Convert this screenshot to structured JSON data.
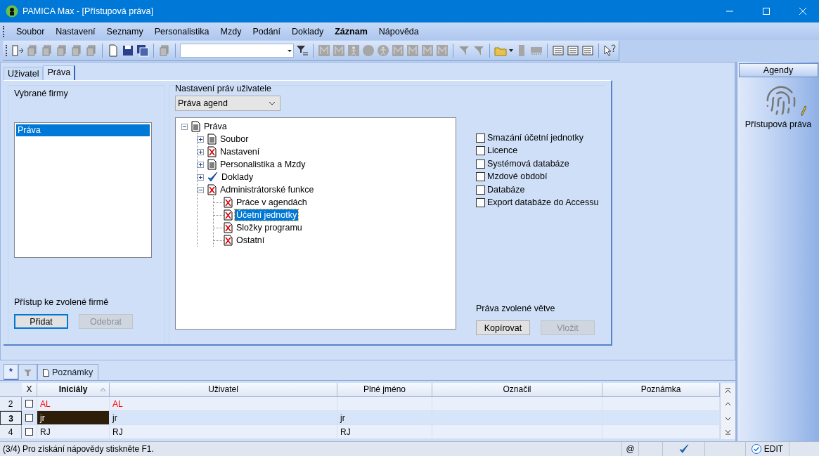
{
  "window": {
    "title": "PAMICA Max - [Přístupová práva]"
  },
  "menu": [
    {
      "label": "Soubor",
      "bold": false
    },
    {
      "label": "Nastavení",
      "bold": false
    },
    {
      "label": "Seznamy",
      "bold": false
    },
    {
      "label": "Personalistika",
      "bold": false
    },
    {
      "label": "Mzdy",
      "bold": false
    },
    {
      "label": "Podání",
      "bold": false
    },
    {
      "label": "Doklady",
      "bold": false
    },
    {
      "label": "Záznam",
      "bold": true
    },
    {
      "label": "Nápověda",
      "bold": false
    }
  ],
  "tabs": [
    {
      "label": "Uživatel",
      "selected": false
    },
    {
      "label": "Práva",
      "selected": true
    }
  ],
  "companies": {
    "title": "Vybrané firmy",
    "items": [
      {
        "label": "Práva",
        "selected": true
      }
    ],
    "access_label": "Přístup ke zvolené firmě",
    "buttons": [
      {
        "label": "Přidat",
        "disabled": false
      },
      {
        "label": "Odebrat",
        "disabled": true
      }
    ]
  },
  "rights": {
    "title": "Nastavení práv uživatele",
    "select": {
      "value": "Práva agend"
    },
    "tree": [
      {
        "label": "Práva",
        "kind": "doc",
        "expanded": true,
        "selected": false,
        "children": [
          {
            "label": "Soubor",
            "kind": "doc",
            "expanded": false,
            "selected": false
          },
          {
            "label": "Nastavení",
            "kind": "denied",
            "expanded": false,
            "selected": false
          },
          {
            "label": "Personalistika a Mzdy",
            "kind": "doc",
            "expanded": false,
            "selected": false
          },
          {
            "label": "Doklady",
            "kind": "check",
            "expanded": false,
            "selected": false
          },
          {
            "label": "Administrátorské funkce",
            "kind": "denied",
            "expanded": true,
            "selected": false,
            "children": [
              {
                "label": "Práce v agendách",
                "kind": "denied",
                "selected": false
              },
              {
                "label": "Účetní jednotky",
                "kind": "denied",
                "selected": true
              },
              {
                "label": "Složky programu",
                "kind": "denied",
                "selected": false
              },
              {
                "label": "Ostatní",
                "kind": "denied",
                "selected": false
              }
            ]
          }
        ]
      }
    ],
    "checkboxes": [
      {
        "label": "Smazání účetní jednotky",
        "checked": false
      },
      {
        "label": "Licence",
        "checked": false
      },
      {
        "label": "Systémová databáze",
        "checked": false
      },
      {
        "label": "Mzdové období",
        "checked": false
      },
      {
        "label": "Databáze",
        "checked": false
      },
      {
        "label": "Export databáze do Accessu",
        "checked": false
      }
    ],
    "branch_label": "Práva zvolené větve",
    "buttons": [
      {
        "label": "Kopírovat",
        "disabled": false
      },
      {
        "label": "Vložit",
        "disabled": true
      }
    ]
  },
  "agendas": {
    "title": "Agendy",
    "items": [
      {
        "label": "Přístupová práva"
      }
    ]
  },
  "grid_tabs": [
    {
      "kind": "text",
      "label": "*",
      "selected": true
    },
    {
      "kind": "filter",
      "selected": false
    },
    {
      "kind": "doc",
      "label": "Poznámky",
      "selected": false
    }
  ],
  "grid": {
    "columns": [
      {
        "label": "X",
        "sorted": false
      },
      {
        "label": "Iniciály",
        "sorted": true
      },
      {
        "label": "Uživatel",
        "sorted": false
      },
      {
        "label": "Plné jméno",
        "sorted": false
      },
      {
        "label": "Označil",
        "sorted": false
      },
      {
        "label": "Poznámka",
        "sorted": false
      }
    ],
    "rows": [
      {
        "number": "2",
        "current": false,
        "checked": false,
        "color": "#ff0000",
        "initials": "AL",
        "user": "AL"
      },
      {
        "number": "3",
        "current": true,
        "checked": false,
        "initials": "jr",
        "user": "jr",
        "full_name": "jr"
      },
      {
        "number": "4",
        "current": false,
        "checked": false,
        "initials": "RJ",
        "user": "RJ",
        "full_name": "RJ"
      }
    ]
  },
  "status_bar": {
    "message": "(3/4) Pro získání nápovědy stiskněte F1.",
    "at": "@",
    "mode": "EDIT"
  }
}
